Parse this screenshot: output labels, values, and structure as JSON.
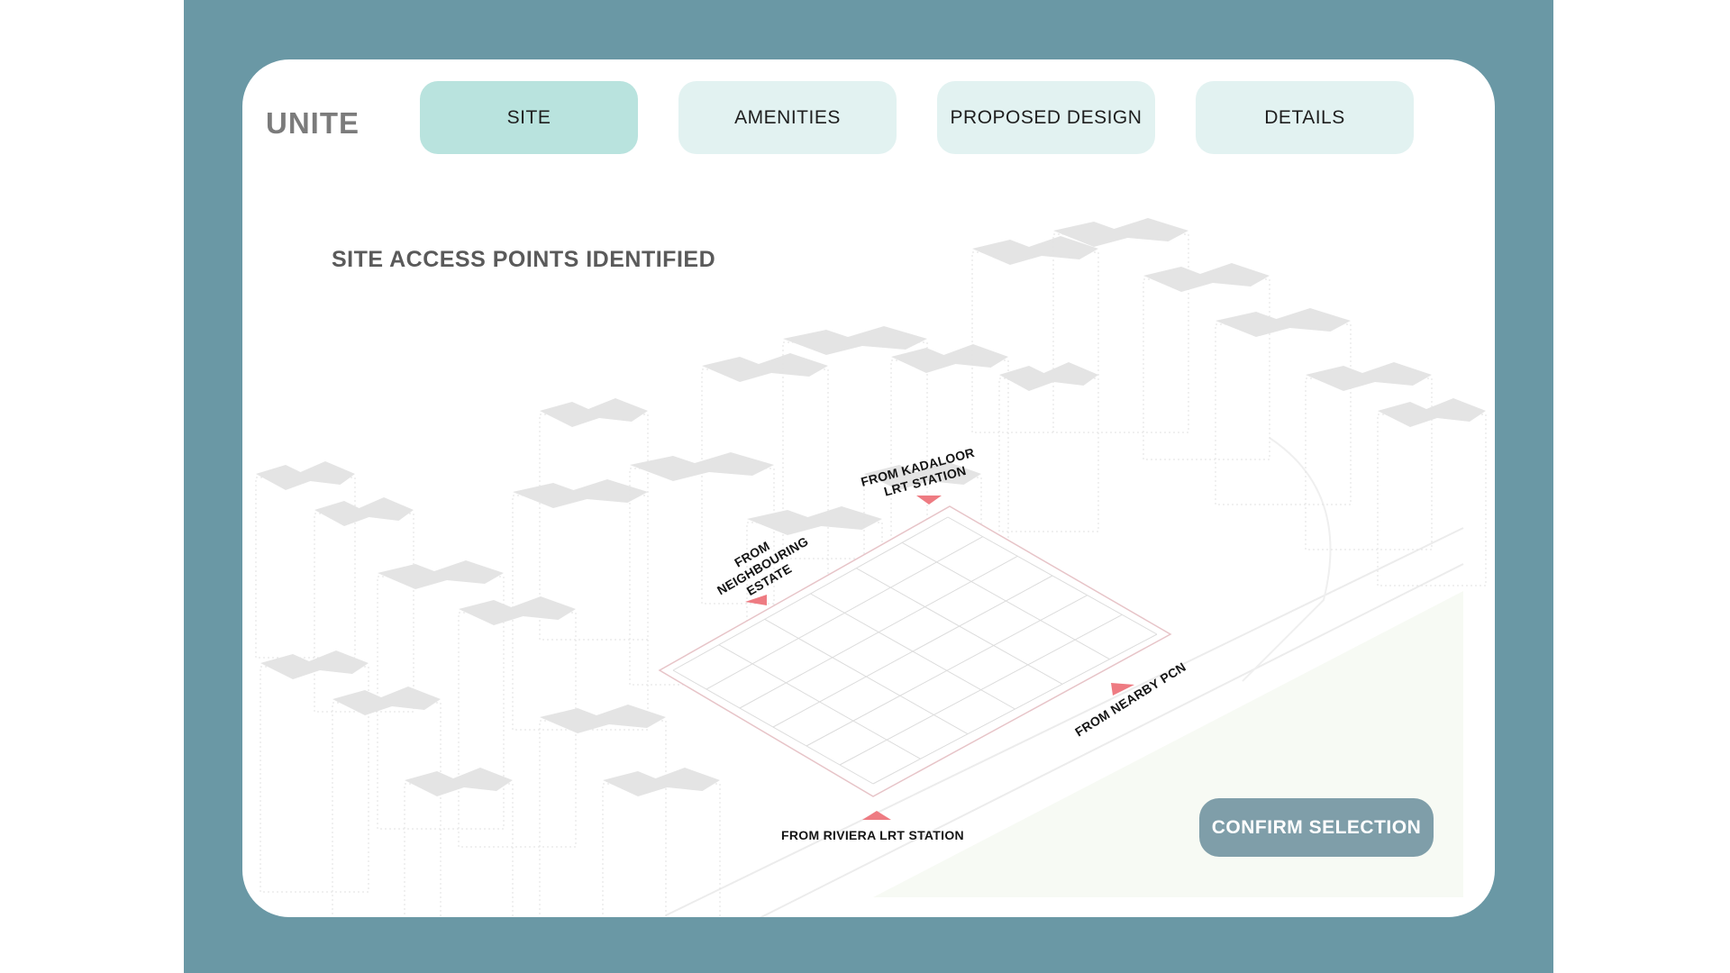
{
  "app": {
    "logo": "UNITE"
  },
  "tabs": [
    {
      "label": "SITE",
      "active": true
    },
    {
      "label": "AMENITIES",
      "active": false
    },
    {
      "label": "PROPOSED DESIGN",
      "active": false
    },
    {
      "label": "DETAILS",
      "active": false
    }
  ],
  "main": {
    "title": "SITE ACCESS POINTS IDENTIFIED",
    "access_points": {
      "kadaloor": [
        "FROM KADALOOR",
        "LRT STATION"
      ],
      "neighbouring": [
        "FROM",
        "NEIGHBOURING",
        "ESTATE"
      ],
      "pcn": "FROM NEARBY PCN",
      "riviera": "FROM RIVIERA LRT STATION"
    },
    "confirm_label": "CONFIRM SELECTION"
  },
  "colors": {
    "frame": "#6a98a5",
    "tab_active": "#b9e3de",
    "tab_inactive": "#e2f2f1",
    "access_marker": "#ee7b82",
    "confirm_button": "#7f9ea9"
  },
  "icons": {
    "access_marker": "triangle-marker-icon"
  }
}
